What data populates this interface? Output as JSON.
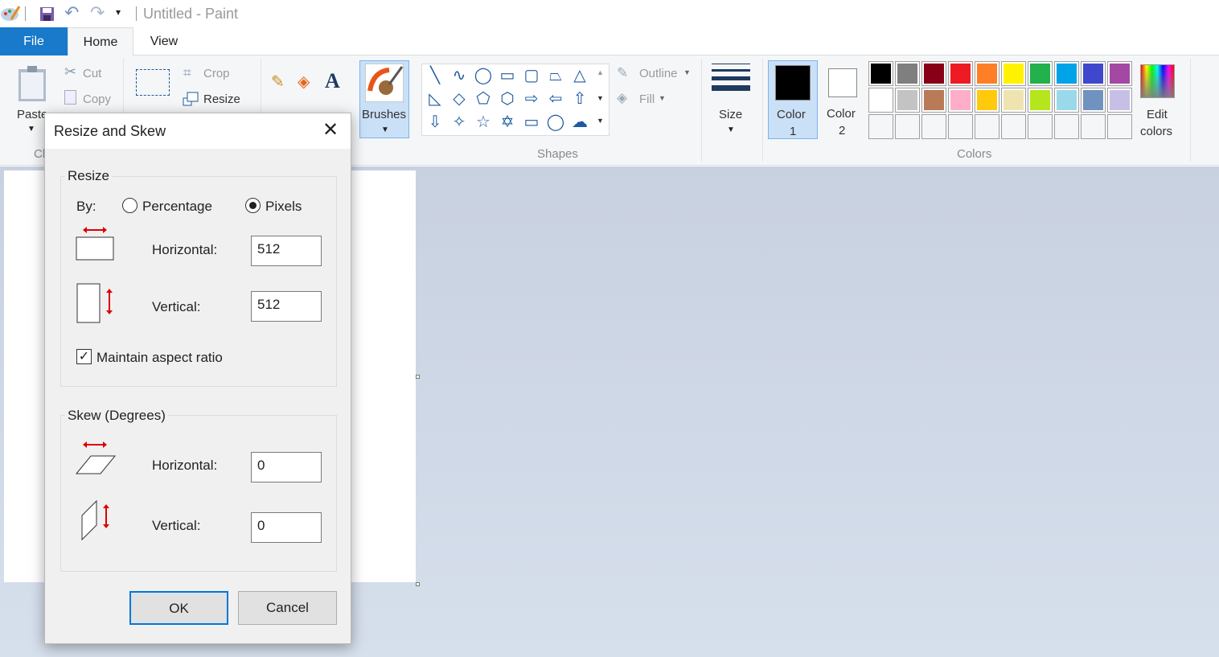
{
  "window": {
    "title": "Untitled - Paint"
  },
  "tabs": [
    {
      "label": "File"
    },
    {
      "label": "Home"
    },
    {
      "label": "View"
    }
  ],
  "clipboard": {
    "paste": "Paste",
    "cut": "Cut",
    "copy": "Copy",
    "group": "Cl"
  },
  "image": {
    "crop": "Crop",
    "resize": "Resize"
  },
  "brushes": {
    "label": "Brushes"
  },
  "shapes": {
    "outline": "Outline",
    "fill": "Fill",
    "group": "Shapes"
  },
  "size": {
    "label": "Size"
  },
  "color1": {
    "label": "Color",
    "num": "1",
    "value": "#000000"
  },
  "color2": {
    "label": "Color",
    "num": "2",
    "value": "#ffffff"
  },
  "colors": {
    "group": "Colors",
    "edit_line1": "Edit",
    "edit_line2": "colors",
    "palette": [
      "#000000",
      "#7f7f7f",
      "#880015",
      "#ed1c24",
      "#ff7f27",
      "#fff200",
      "#22b14c",
      "#00a2e8",
      "#3f48cc",
      "#a349a4",
      "#ffffff",
      "#c3c3c3",
      "#b97a57",
      "#ffaec9",
      "#ffc90e",
      "#efe4b0",
      "#b5e61d",
      "#99d9ea",
      "#7092be",
      "#c8bfe7"
    ]
  },
  "dialog": {
    "title": "Resize and Skew",
    "resize": {
      "legend": "Resize",
      "by": "By:",
      "percentage": "Percentage",
      "pixels": "Pixels",
      "selected": "Pixels",
      "horizontal_label": "Horizontal:",
      "horizontal": "512",
      "vertical_label": "Vertical:",
      "vertical": "512",
      "aspect": "Maintain aspect ratio",
      "aspect_checked": true
    },
    "skew": {
      "legend": "Skew (Degrees)",
      "horizontal_label": "Horizontal:",
      "horizontal": "0",
      "vertical_label": "Vertical:",
      "vertical": "0"
    },
    "ok": "OK",
    "cancel": "Cancel"
  }
}
